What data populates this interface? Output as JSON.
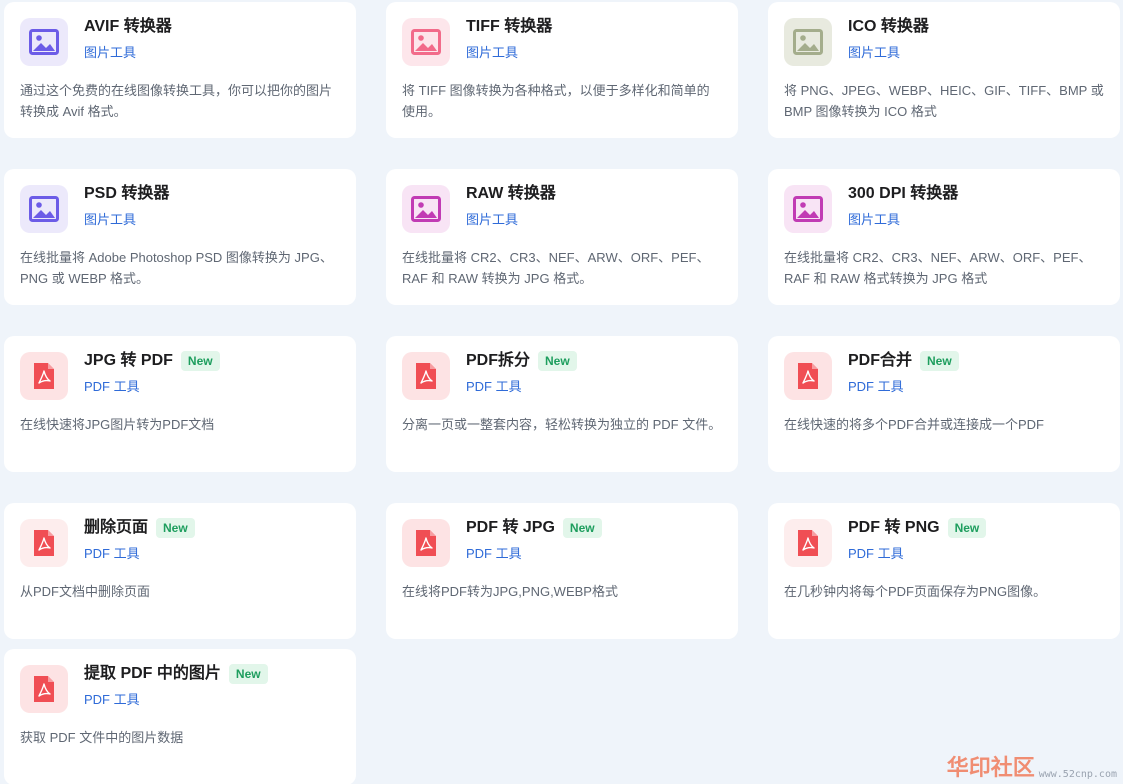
{
  "cards": [
    {
      "title": "AVIF 转换器",
      "category": "图片工具",
      "desc": "通过这个免费的在线图像转换工具，你可以把你的图片转换成 Avif 格式。",
      "icon": "image-icon",
      "icon_color": "#6c5ce7",
      "icon_bg": "#ece9fb"
    },
    {
      "title": "TIFF 转换器",
      "category": "图片工具",
      "desc": "将 TIFF 图像转换为各种格式，以便于多样化和简单的使用。",
      "icon": "image-icon",
      "icon_color": "#f26b8a",
      "icon_bg": "#fde6eb"
    },
    {
      "title": "ICO 转换器",
      "category": "图片工具",
      "desc": "将 PNG、JPEG、WEBP、HEIC、GIF、TIFF、BMP 或 BMP 图像转换为 ICO 格式",
      "icon": "image-icon",
      "icon_color": "#a4ad8c",
      "icon_bg": "#e8eadf"
    },
    {
      "title": "PSD 转换器",
      "category": "图片工具",
      "desc": "在线批量将 Adobe Photoshop PSD 图像转换为 JPG、PNG 或 WEBP 格式。",
      "icon": "image-icon",
      "icon_color": "#6c5ce7",
      "icon_bg": "#ece9fb"
    },
    {
      "title": "RAW 转换器",
      "category": "图片工具",
      "desc": "在线批量将 CR2、CR3、NEF、ARW、ORF、PEF、RAF 和 RAW 转换为 JPG 格式。",
      "icon": "image-icon",
      "icon_color": "#c13bb4",
      "icon_bg": "#f8e4f5"
    },
    {
      "title": "300 DPI 转换器",
      "category": "图片工具",
      "desc": "在线批量将 CR2、CR3、NEF、ARW、ORF、PEF、RAF 和 RAW 格式转换为 JPG 格式",
      "icon": "image-icon",
      "icon_color": "#c13bb4",
      "icon_bg": "#f8e4f5"
    },
    {
      "title": "JPG 转 PDF",
      "badge": "New",
      "category": "PDF 工具",
      "desc": "在线快速将JPG图片转为PDF文档",
      "icon": "pdf-icon",
      "icon_color": "#f04e54",
      "icon_bg": "#fde3e4"
    },
    {
      "title": "PDF拆分",
      "badge": "New",
      "category": "PDF 工具",
      "desc": "分离一页或一整套内容，轻松转换为独立的 PDF 文件。",
      "icon": "pdf-icon",
      "icon_color": "#f04e54",
      "icon_bg": "#fde3e4"
    },
    {
      "title": "PDF合并",
      "badge": "New",
      "category": "PDF 工具",
      "desc": "在线快速的将多个PDF合并或连接成一个PDF",
      "icon": "pdf-icon",
      "icon_color": "#f04e54",
      "icon_bg": "#fde3e4"
    },
    {
      "title": "删除页面",
      "badge": "New",
      "category": "PDF 工具",
      "desc": "从PDF文档中删除页面",
      "icon": "pdf-icon",
      "icon_color": "#f04e54",
      "icon_bg": "#fdeded"
    },
    {
      "title": "PDF 转 JPG",
      "badge": "New",
      "category": "PDF 工具",
      "desc": "在线将PDF转为JPG,PNG,WEBP格式",
      "icon": "pdf-icon",
      "icon_color": "#f04e54",
      "icon_bg": "#fde3e4"
    },
    {
      "title": "PDF 转 PNG",
      "badge": "New",
      "category": "PDF 工具",
      "desc": "在几秒钟内将每个PDF页面保存为PNG图像。",
      "icon": "pdf-icon",
      "icon_color": "#f04e54",
      "icon_bg": "#fdeded"
    },
    {
      "title": "提取 PDF 中的图片",
      "badge": "New",
      "category": "PDF 工具",
      "desc": "获取 PDF 文件中的图片数据",
      "icon": "pdf-icon",
      "icon_color": "#f04e54",
      "icon_bg": "#fde3e4"
    }
  ],
  "watermark": {
    "text": "华印社区",
    "url": "www.52cnp.com"
  }
}
